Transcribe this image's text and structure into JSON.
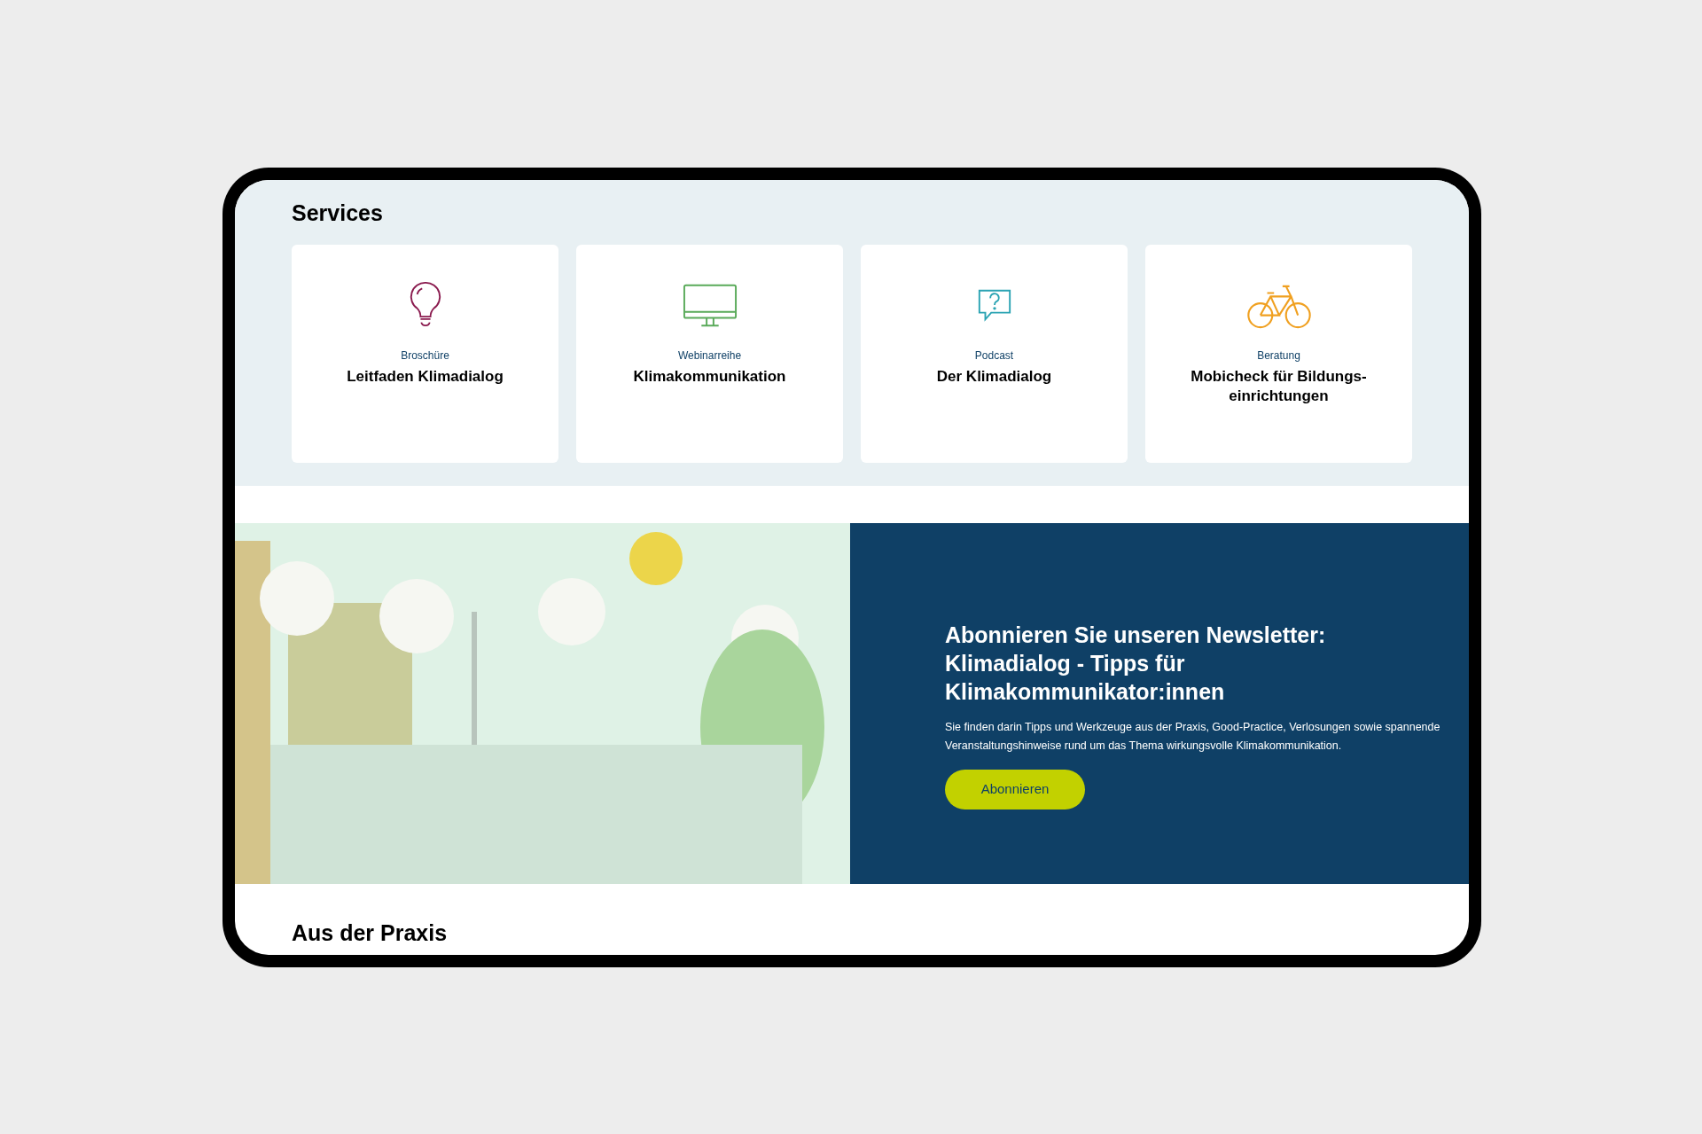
{
  "services": {
    "heading": "Services",
    "cards": [
      {
        "kind": "bulb",
        "color": "#8a1a4e",
        "category": "Broschüre",
        "title": "Leitfaden Klimadialog"
      },
      {
        "kind": "monitor",
        "color": "#5aaa5a",
        "category": "Webinarreihe",
        "title": "Klimakommunikation"
      },
      {
        "kind": "question",
        "color": "#2aa3b3",
        "category": "Podcast",
        "title": "Der Klimadialog"
      },
      {
        "kind": "bike",
        "color": "#f0a020",
        "category": "Beratung",
        "title": "Mobicheck für Bildungs-einrichtungen"
      }
    ]
  },
  "newsletter": {
    "heading": "Abonnieren Sie unseren Newsletter: Klimadialog - Tipps für Klimakommunikator:innen",
    "text": "Sie finden darin Tipps und Werkzeuge aus der Praxis, Good-Practice, Verlosungen sowie spannende Veranstaltungshinweise rund um das Thema wirkungsvolle Klimakommunikation.",
    "button": "Abonnieren"
  },
  "praxis": {
    "heading": "Aus der Praxis"
  }
}
